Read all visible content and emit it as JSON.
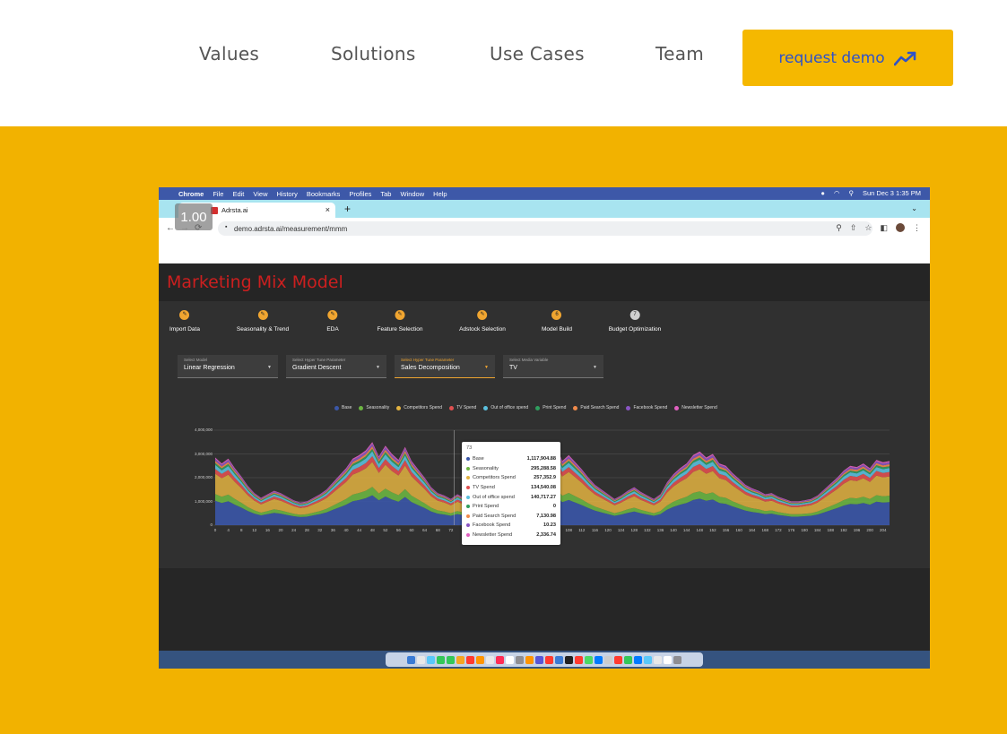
{
  "nav": {
    "links": [
      "Values",
      "Solutions",
      "Use Cases",
      "Team"
    ],
    "cta_label": "request demo",
    "cta_icon": "trending-up-icon",
    "cta_bg": "#f5b800",
    "cta_text_color": "#2e52c9"
  },
  "hero": {
    "bg": "#f2b200"
  },
  "screenshot": {
    "mac_menu": {
      "app": "Chrome",
      "items": [
        "File",
        "Edit",
        "View",
        "History",
        "Bookmarks",
        "Profiles",
        "Tab",
        "Window",
        "Help"
      ],
      "clock": "Sun Dec 3  1:35 PM"
    },
    "zoom_badge": "1.00",
    "tab_title": "Adrsta.ai",
    "url": "demo.adrsta.ai/measurement/mmm",
    "app_title": "Marketing Mix Model",
    "steps": [
      {
        "label": "Import Data",
        "marker": "pencil-icon"
      },
      {
        "label": "Seasonality & Trend",
        "marker": "pencil-icon"
      },
      {
        "label": "EDA",
        "marker": "pencil-icon"
      },
      {
        "label": "Feature Selection",
        "marker": "pencil-icon"
      },
      {
        "label": "Adstock Selection",
        "marker": "pencil-icon"
      },
      {
        "label": "Model Build",
        "marker": "6"
      },
      {
        "label": "Budget Optimization",
        "marker": "7"
      }
    ],
    "selects": [
      {
        "label": "Select Model",
        "value": "Linear Regression"
      },
      {
        "label": "Select Hyper Tune Parameter",
        "value": "Gradient Descent"
      },
      {
        "label": "Select Hyper Tune Parameter",
        "value": "Sales Decomposition"
      },
      {
        "label": "Select Media Variable",
        "value": "TV"
      }
    ],
    "chart_data": {
      "type": "area",
      "stacked": true,
      "series": [
        {
          "name": "Base",
          "color": "#3b57a8"
        },
        {
          "name": "Seasonality",
          "color": "#6cb542"
        },
        {
          "name": "Competitors Spend",
          "color": "#e3b341"
        },
        {
          "name": "TV Spend",
          "color": "#e05050"
        },
        {
          "name": "Out of office spend",
          "color": "#5bc0de"
        },
        {
          "name": "Print Spend",
          "color": "#2f9e5e"
        },
        {
          "name": "Paid Search Spend",
          "color": "#f08a4b"
        },
        {
          "name": "Facebook Spend",
          "color": "#8a55c4"
        },
        {
          "name": "Newsletter Spend",
          "color": "#e060c0"
        }
      ],
      "y_ticks": [
        "4,000,000",
        "3,000,000",
        "2,000,000",
        "1,000,000",
        "0"
      ],
      "ylim": [
        0,
        4000000
      ],
      "x_ticks": [
        "0",
        "4",
        "8",
        "12",
        "16",
        "20",
        "24",
        "28",
        "32",
        "36",
        "40",
        "44",
        "48",
        "52",
        "56",
        "60",
        "64",
        "68",
        "72",
        "76",
        "80",
        "84",
        "88",
        "92",
        "96",
        "100",
        "104",
        "108",
        "112",
        "116",
        "120",
        "124",
        "128",
        "132",
        "136",
        "140",
        "144",
        "148",
        "152",
        "156",
        "160",
        "164",
        "168",
        "172",
        "176",
        "180",
        "184",
        "188",
        "192",
        "196",
        "200",
        "204"
      ],
      "xlim": [
        0,
        206
      ],
      "total_envelope": [
        [
          0,
          2850000
        ],
        [
          2,
          2600000
        ],
        [
          4,
          2800000
        ],
        [
          6,
          2400000
        ],
        [
          8,
          2050000
        ],
        [
          10,
          1650000
        ],
        [
          12,
          1350000
        ],
        [
          14,
          1150000
        ],
        [
          16,
          1300000
        ],
        [
          18,
          1450000
        ],
        [
          20,
          1350000
        ],
        [
          22,
          1200000
        ],
        [
          24,
          1050000
        ],
        [
          26,
          950000
        ],
        [
          28,
          1000000
        ],
        [
          30,
          1150000
        ],
        [
          32,
          1300000
        ],
        [
          34,
          1500000
        ],
        [
          36,
          1800000
        ],
        [
          38,
          2100000
        ],
        [
          40,
          2400000
        ],
        [
          42,
          2800000
        ],
        [
          44,
          2950000
        ],
        [
          46,
          3150000
        ],
        [
          48,
          3500000
        ],
        [
          50,
          2900000
        ],
        [
          52,
          3350000
        ],
        [
          54,
          3000000
        ],
        [
          56,
          2750000
        ],
        [
          58,
          3300000
        ],
        [
          60,
          2700000
        ],
        [
          62,
          2350000
        ],
        [
          64,
          2000000
        ],
        [
          66,
          1600000
        ],
        [
          68,
          1350000
        ],
        [
          70,
          1250000
        ],
        [
          72,
          1100000
        ],
        [
          74,
          1300000
        ],
        [
          76,
          1150000
        ],
        [
          78,
          1000000
        ],
        [
          80,
          1050000
        ],
        [
          82,
          1200000
        ],
        [
          84,
          1150000
        ],
        [
          86,
          1000000
        ],
        [
          88,
          1250000
        ],
        [
          90,
          1500000
        ],
        [
          92,
          1950000
        ],
        [
          94,
          2300000
        ],
        [
          96,
          2450000
        ],
        [
          98,
          2700000
        ],
        [
          100,
          2500000
        ],
        [
          102,
          2800000
        ],
        [
          104,
          3400000
        ],
        [
          106,
          2700000
        ],
        [
          108,
          2950000
        ],
        [
          110,
          2650000
        ],
        [
          112,
          2350000
        ],
        [
          114,
          2000000
        ],
        [
          116,
          1700000
        ],
        [
          118,
          1500000
        ],
        [
          120,
          1300000
        ],
        [
          122,
          1100000
        ],
        [
          124,
          1250000
        ],
        [
          126,
          1450000
        ],
        [
          128,
          1600000
        ],
        [
          130,
          1400000
        ],
        [
          132,
          1250000
        ],
        [
          134,
          1100000
        ],
        [
          136,
          1300000
        ],
        [
          138,
          1800000
        ],
        [
          140,
          2150000
        ],
        [
          142,
          2400000
        ],
        [
          144,
          2600000
        ],
        [
          146,
          2950000
        ],
        [
          148,
          3100000
        ],
        [
          150,
          2850000
        ],
        [
          152,
          3000000
        ],
        [
          154,
          2600000
        ],
        [
          156,
          2500000
        ],
        [
          158,
          2200000
        ],
        [
          160,
          1950000
        ],
        [
          162,
          1700000
        ],
        [
          164,
          1550000
        ],
        [
          166,
          1450000
        ],
        [
          168,
          1300000
        ],
        [
          170,
          1350000
        ],
        [
          172,
          1200000
        ],
        [
          174,
          1100000
        ],
        [
          176,
          1000000
        ],
        [
          178,
          1000000
        ],
        [
          180,
          1050000
        ],
        [
          182,
          1100000
        ],
        [
          184,
          1250000
        ],
        [
          186,
          1500000
        ],
        [
          188,
          1750000
        ],
        [
          190,
          2000000
        ],
        [
          192,
          2300000
        ],
        [
          194,
          2500000
        ],
        [
          196,
          2450000
        ],
        [
          198,
          2600000
        ],
        [
          200,
          2400000
        ],
        [
          202,
          2750000
        ],
        [
          204,
          2650000
        ],
        [
          206,
          2700000
        ]
      ],
      "tooltip": {
        "title": "73",
        "rows": [
          {
            "name": "Base",
            "value": "1,117,904.88"
          },
          {
            "name": "Seasonality",
            "value": "295,288.58"
          },
          {
            "name": "Competitors Spend",
            "value": "257,352.9"
          },
          {
            "name": "TV Spend",
            "value": "134,540.08"
          },
          {
            "name": "Out of office spend",
            "value": "140,717.27"
          },
          {
            "name": "Print Spend",
            "value": "0"
          },
          {
            "name": "Paid Search Spend",
            "value": "7,130.98"
          },
          {
            "name": "Facebook Spend",
            "value": "10.23"
          },
          {
            "name": "Newsletter Spend",
            "value": "2,336.74"
          }
        ]
      },
      "grid": true,
      "legend_position": "top"
    }
  }
}
